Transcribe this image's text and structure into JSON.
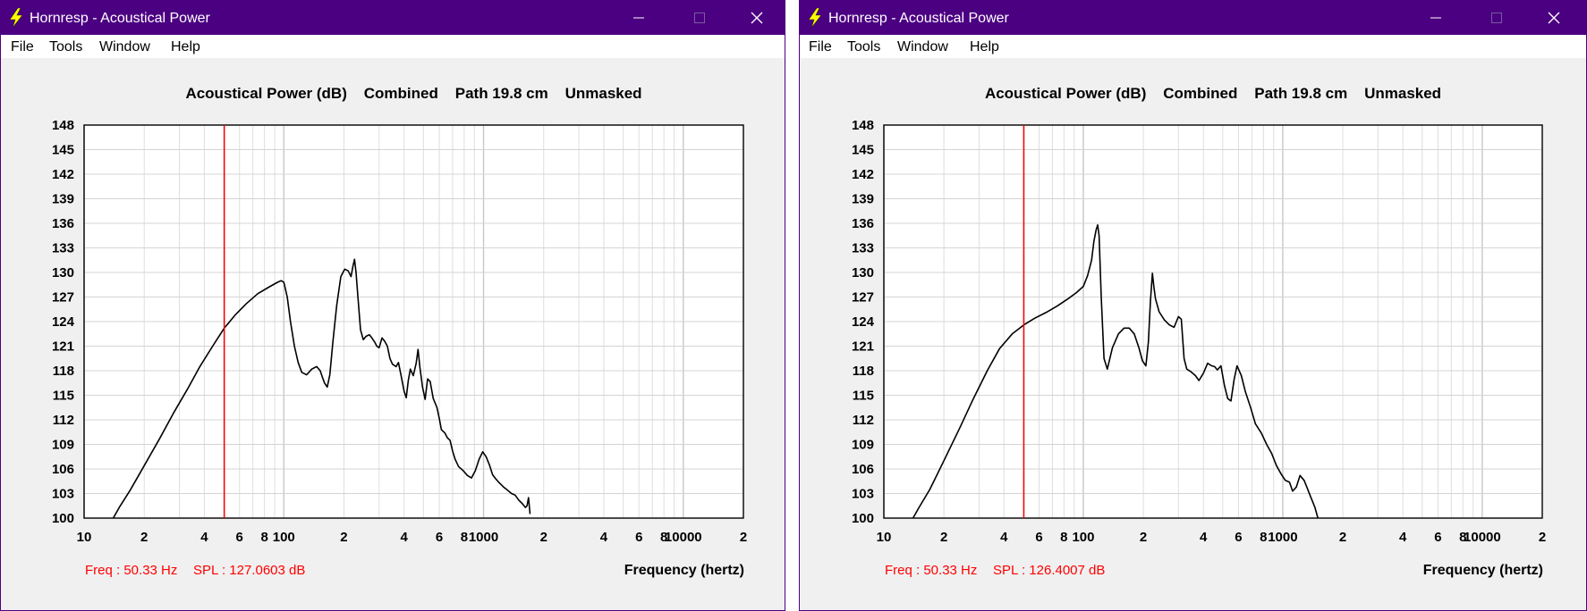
{
  "windows": [
    {
      "title": "Hornresp - Acoustical Power",
      "menu": [
        "File",
        "Tools",
        "Window",
        "Help"
      ],
      "readout": {
        "freq": "Freq : 50.33 Hz",
        "spl": "SPL : 127.0603 dB"
      },
      "chart_data": {
        "type": "line",
        "title": "Acoustical Power (dB)    Combined    Path 19.8 cm    Unmasked",
        "xlabel": "Frequency (hertz)",
        "ylabel": "",
        "x_scale": "log",
        "xlim": [
          10,
          20000
        ],
        "ylim": [
          100,
          148
        ],
        "x_tick_labels": [
          "10",
          "2",
          "4",
          "6",
          "8",
          "100",
          "2",
          "4",
          "6",
          "8",
          "1000",
          "2",
          "4",
          "6",
          "8",
          "10000",
          "2"
        ],
        "y_ticks": [
          100,
          103,
          106,
          109,
          112,
          115,
          118,
          121,
          124,
          127,
          130,
          133,
          136,
          139,
          142,
          145,
          148
        ],
        "grid": true,
        "marker_freq": 50.33,
        "series": [
          {
            "color": "#000000",
            "x": [
              14,
              15,
              17,
              20,
              24,
              28,
              33,
              38,
              44,
              50.33,
              57,
              65,
              74,
              84,
              93,
              97,
              100,
              104,
              108,
              113,
              118,
              123,
              130,
              138,
              146,
              152,
              156,
              160,
              165,
              170,
              176,
              184,
              193,
              202,
              210,
              217,
              222,
              226,
              230,
              235,
              242,
              250,
              258,
              268,
              276,
              285,
              292,
              300,
              310,
              320,
              330,
              340,
              350,
              365,
              375,
              385,
              400,
              410,
              420,
              430,
              445,
              460,
              470,
              480,
              495,
              510,
              525,
              540,
              560,
              585,
              600,
              615,
              640,
              660,
              680,
              700,
              720,
              750,
              790,
              830,
              870,
              910,
              950,
              990,
              1030,
              1070,
              1110,
              1150,
              1200,
              1260,
              1320,
              1380,
              1440,
              1500,
              1560,
              1620,
              1650,
              1680,
              1710
            ],
            "y": [
              100,
              101.3,
              103.4,
              106.4,
              109.8,
              112.8,
              115.8,
              118.5,
              121,
              123.2,
              124.8,
              126.2,
              127.4,
              128.2,
              128.8,
              129.0,
              128.8,
              127,
              124,
              121,
              119,
              117.8,
              117.5,
              118.2,
              118.5,
              118,
              117.2,
              116.5,
              116,
              117.5,
              121.5,
              126,
              129.5,
              130.4,
              130.2,
              129.5,
              130.8,
              131.6,
              130,
              127,
              123,
              121.8,
              122.2,
              122.4,
              122.0,
              121.5,
              121.0,
              120.8,
              122.0,
              121.6,
              121.0,
              119.5,
              118.8,
              118.5,
              119.0,
              117.6,
              115.5,
              114.7,
              116.8,
              118.2,
              117.4,
              118.9,
              120.6,
              118.4,
              116,
              114.5,
              117,
              116.7,
              114.6,
              113.5,
              112.2,
              110.8,
              110.4,
              109.8,
              109.5,
              108.2,
              107.2,
              106.3,
              105.8,
              105.2,
              104.9,
              105.8,
              107.2,
              108.1,
              107.5,
              106.5,
              105.3,
              104.8,
              104.3,
              103.8,
              103.4,
              103.0,
              102.8,
              102.2,
              101.8,
              101.3,
              101.5,
              102.5,
              100.5
            ]
          }
        ]
      }
    },
    {
      "title": "Hornresp - Acoustical Power",
      "menu": [
        "File",
        "Tools",
        "Window",
        "Help"
      ],
      "readout": {
        "freq": "Freq : 50.33 Hz",
        "spl": "SPL : 126.4007 dB"
      },
      "chart_data": {
        "type": "line",
        "title": "Acoustical Power (dB)    Combined    Path 19.8 cm    Unmasked",
        "xlabel": "Frequency (hertz)",
        "ylabel": "",
        "x_scale": "log",
        "xlim": [
          10,
          20000
        ],
        "ylim": [
          100,
          148
        ],
        "x_tick_labels": [
          "10",
          "2",
          "4",
          "6",
          "8",
          "100",
          "2",
          "4",
          "6",
          "8",
          "1000",
          "2",
          "4",
          "6",
          "8",
          "10000",
          "2"
        ],
        "y_ticks": [
          100,
          103,
          106,
          109,
          112,
          115,
          118,
          121,
          124,
          127,
          130,
          133,
          136,
          139,
          142,
          145,
          148
        ],
        "grid": true,
        "marker_freq": 50.33,
        "series": [
          {
            "color": "#000000",
            "x": [
              14,
              15,
              17,
              20,
              24,
              28,
              33,
              38,
              44,
              50.33,
              57,
              65,
              74,
              84,
              92,
              100,
              105,
              110,
              113,
              116,
              118,
              120,
              123,
              127,
              132,
              140,
              150,
              160,
              170,
              180,
              190,
              198,
              206,
              212,
              217,
              222,
              226,
              230,
              240,
              255,
              270,
              285,
              300,
              310,
              320,
              330,
              345,
              365,
              380,
              400,
              420,
              440,
              455,
              470,
              490,
              510,
              530,
              550,
              570,
              590,
              620,
              650,
              690,
              730,
              780,
              830,
              880,
              930,
              980,
              1030,
              1080,
              1120,
              1170,
              1220,
              1280,
              1320,
              1380,
              1450,
              1500
            ],
            "y": [
              100,
              101.3,
              103.5,
              107,
              111,
              114.5,
              118,
              120.7,
              122.5,
              123.6,
              124.4,
              125.1,
              125.9,
              126.8,
              127.5,
              128.3,
              129.6,
              131.5,
              133.8,
              135.2,
              135.8,
              134.5,
              127,
              119.5,
              118.2,
              120.8,
              122.5,
              123.2,
              123.2,
              122.5,
              120.8,
              119.2,
              118.6,
              121.5,
              126.5,
              129.9,
              128.2,
              126.8,
              125.2,
              124.2,
              123.6,
              123.3,
              124.6,
              124.3,
              119.5,
              118.2,
              117.9,
              117.4,
              116.8,
              117.7,
              118.9,
              118.6,
              118.5,
              118.1,
              118.6,
              116.2,
              114.6,
              114.3,
              116.9,
              118.6,
              117.4,
              115.4,
              113.5,
              111.5,
              110.4,
              109,
              107.9,
              106.4,
              105.4,
              104.6,
              104.4,
              103.3,
              103.8,
              105.2,
              104.6,
              103.8,
              102.6,
              101.3,
              100
            ]
          }
        ]
      }
    }
  ],
  "icons": {
    "app": "lightning-bolt-icon",
    "minimize": "minimize-icon",
    "maximize": "maximize-icon",
    "close": "close-icon"
  },
  "colors": {
    "titlebar": "#4b0082",
    "marker": "#ff0000",
    "trace": "#000000",
    "app_icon": "#ffff00"
  }
}
